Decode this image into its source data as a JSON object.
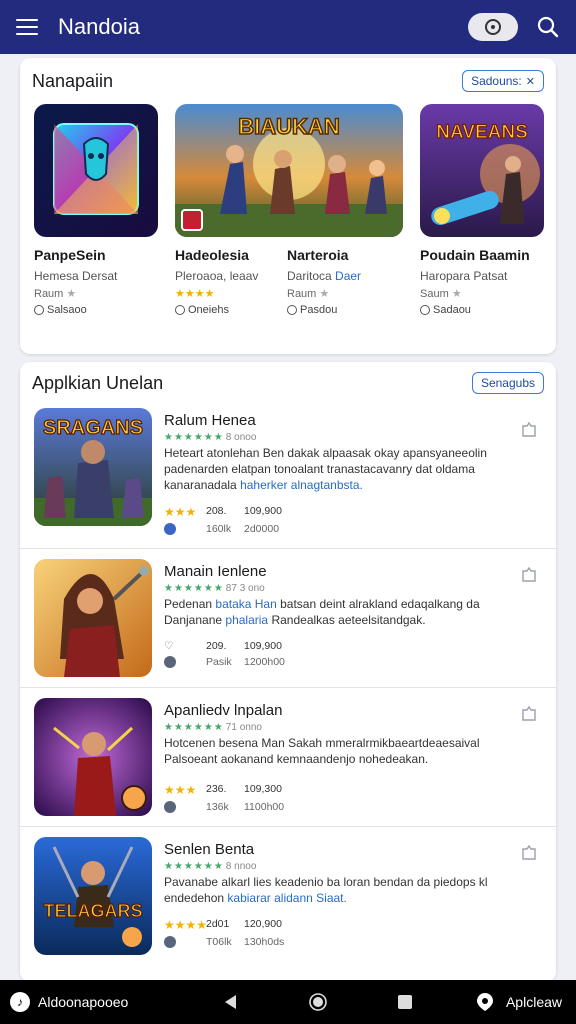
{
  "app": {
    "title": "Nandoia"
  },
  "featured": {
    "title": "Nanapaiin",
    "see_all": "Sadouns:",
    "items": [
      {
        "title": "PanpeSein",
        "sub": "Hemesa Dersat",
        "meta": "Raum",
        "rating_stars": 0,
        "downloads": "Salsaoo"
      },
      {
        "title": "Hadeolesia",
        "sub": "Pleroaoa, leaav",
        "meta": "",
        "rating_stars": 4,
        "downloads": "Oneiehs",
        "banner": "BIAUKAN"
      },
      {
        "title": "Narteroia",
        "sub": "Daritoca",
        "sub_link": "Daer",
        "meta": "Raum",
        "rating_stars": 0,
        "downloads": "Pasdou"
      },
      {
        "title": "Poudain Baamin",
        "sub": "Haropara Patsat",
        "meta": "Saum",
        "rating_stars": 0,
        "downloads": "Sadaou",
        "banner": "NAVEANS"
      }
    ]
  },
  "apps_section": {
    "title": "Applkian Unelan",
    "see_all": "Senagubs",
    "items": [
      {
        "title": "Ralum Henea",
        "rating_text": "★★★★★★",
        "rating_count": "8 onoo",
        "desc_line1": "Heteart atonlehan Ben dakak alpaasak okay apansyaneeolin",
        "desc_line2": "padenarden elatpan tonoalant tranastacavanry dat oldama",
        "desc_line3": "kanaranadala",
        "desc_link": "haherker alnagtanbsta.",
        "stars": "★★★",
        "stat1": "208.",
        "stat2": "109,900",
        "stat3": "160lk",
        "stat4": "2d0000",
        "banner": "SRAGANS"
      },
      {
        "title": "Manain Ienlene",
        "rating_text": "★★★★★★",
        "rating_count": "87 3 ono",
        "desc_pre": "Pedenan",
        "desc_link": "bataka Han",
        "desc_line1": "batsan deint alrakland edaqalkang da",
        "desc_line2": "Danjanane",
        "desc_link2": "phalaria",
        "desc_line2b": "Randealkas aeteelsitandgak.",
        "stars": "",
        "stat1": "209.",
        "stat2": "109,900",
        "stat3": "Pasik",
        "stat4": "1200h00",
        "banner": ""
      },
      {
        "title": "Apanliedv lnpalan",
        "rating_text": "★★★★★★",
        "rating_count": "71 onno",
        "desc_line1": "Hotcenen besena Man Sakah mmeralrmikbaeartdeaesaival",
        "desc_line2": "Palsoeant aokanand kemnaandenjo nohedeakan.",
        "stars": "★★★",
        "stat1": "236.",
        "stat2": "109,300",
        "stat3": "136k",
        "stat4": "1100h00",
        "banner": ""
      },
      {
        "title": "Senlen Benta",
        "rating_text": "★★★★★★",
        "rating_count": "8 nnoo",
        "desc_line1": "Pavanabe alkarl lies keadenio ba loran bendan da piedops kl",
        "desc_line2": "endedehon",
        "desc_link": "kabiarar alidann Siaat.",
        "stars": "★★★★",
        "stat1": "2d01",
        "stat2": "120,900",
        "stat3": "T06lk",
        "stat4": "130h0ds",
        "banner": "TELAGARS"
      }
    ]
  },
  "navbar": {
    "left_label": "Aldoonapooeo",
    "right_label": "Aplcleaw"
  },
  "colors": {
    "topbar": "#222b7e",
    "accent": "#3a7bd5",
    "rating_green": "#47a66b",
    "star_yellow": "#f2b200"
  }
}
